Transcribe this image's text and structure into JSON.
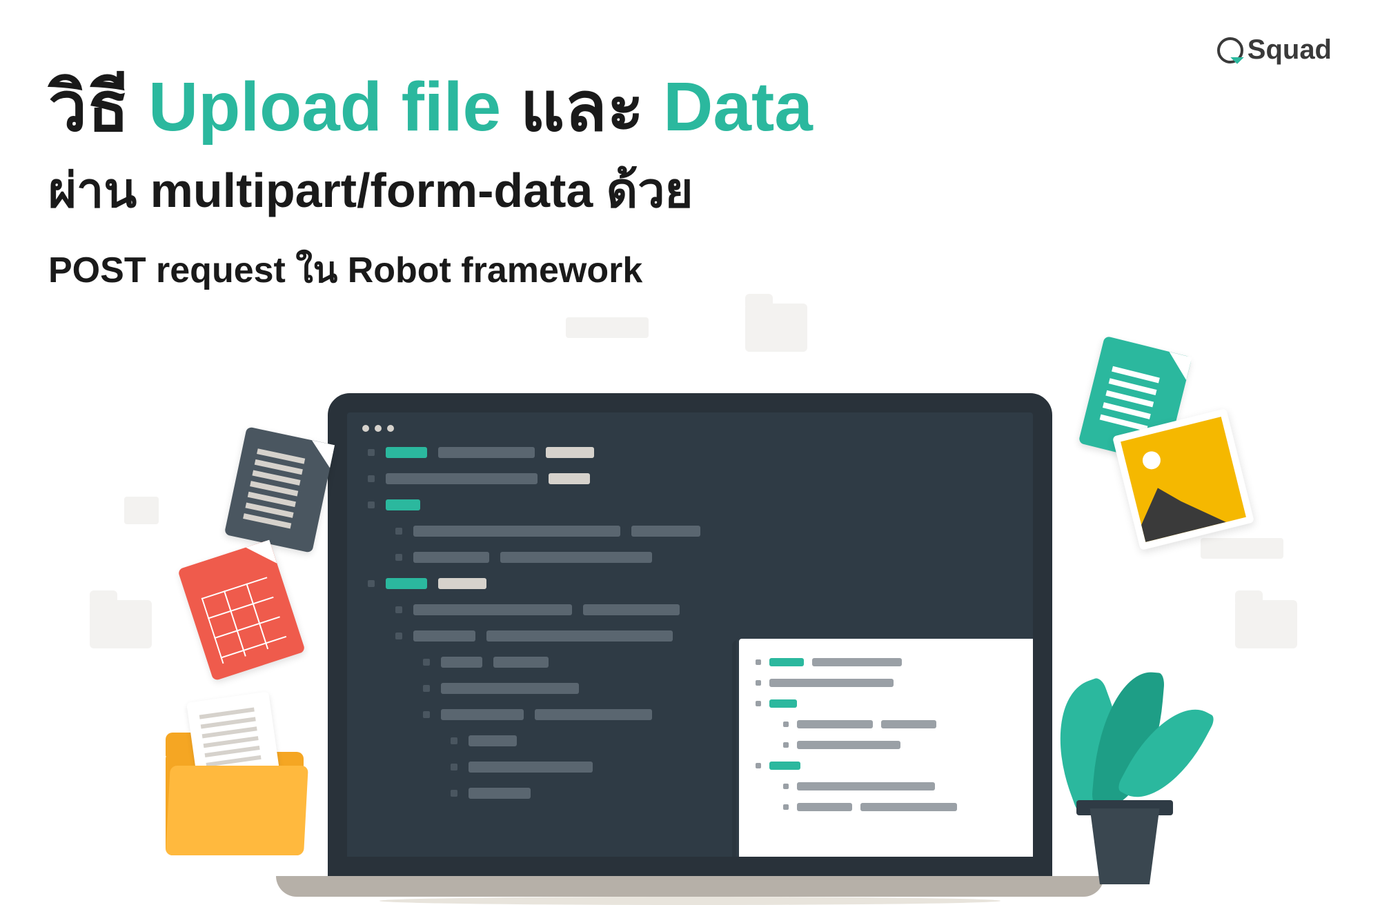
{
  "logo": {
    "text": "Squad"
  },
  "title": {
    "line1_a": "วิธี ",
    "line1_b": "Upload file",
    "line1_c": " และ ",
    "line1_d": "Data",
    "line2": "ผ่าน multipart/form-data ด้วย",
    "line3": "POST request ใน Robot framework"
  }
}
